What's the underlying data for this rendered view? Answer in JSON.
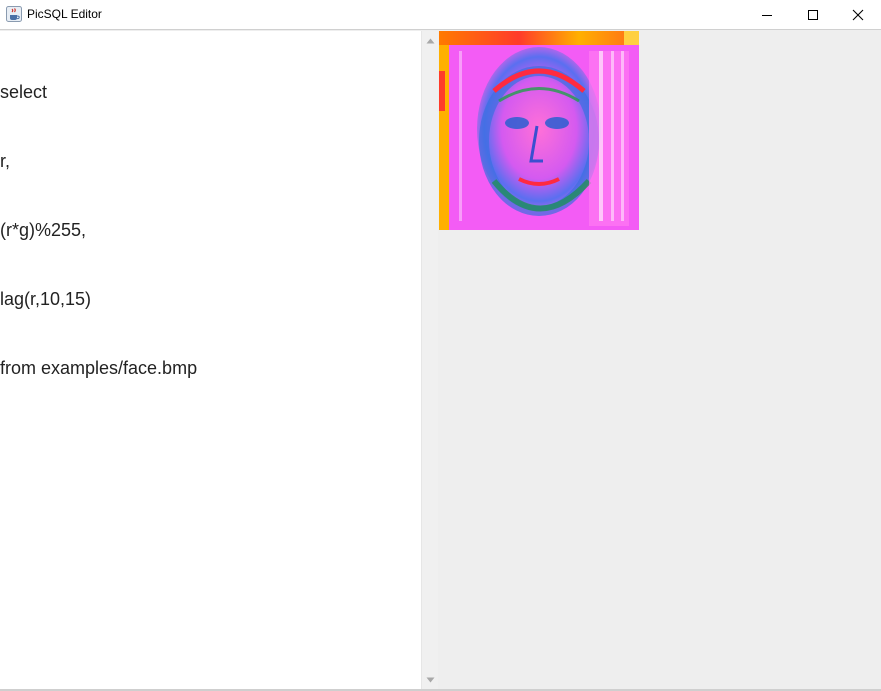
{
  "window": {
    "title": "PicSQL Editor",
    "icon": "java-cup-icon",
    "controls": [
      "minimize-icon",
      "maximize-icon",
      "close-icon"
    ]
  },
  "editor": {
    "lines": [
      "select",
      "r,",
      "(r*g)%255,",
      "lag(r,10,15)",
      "from examples/face.bmp"
    ]
  },
  "output": {
    "image_subject": "psychedelic-face-image"
  }
}
